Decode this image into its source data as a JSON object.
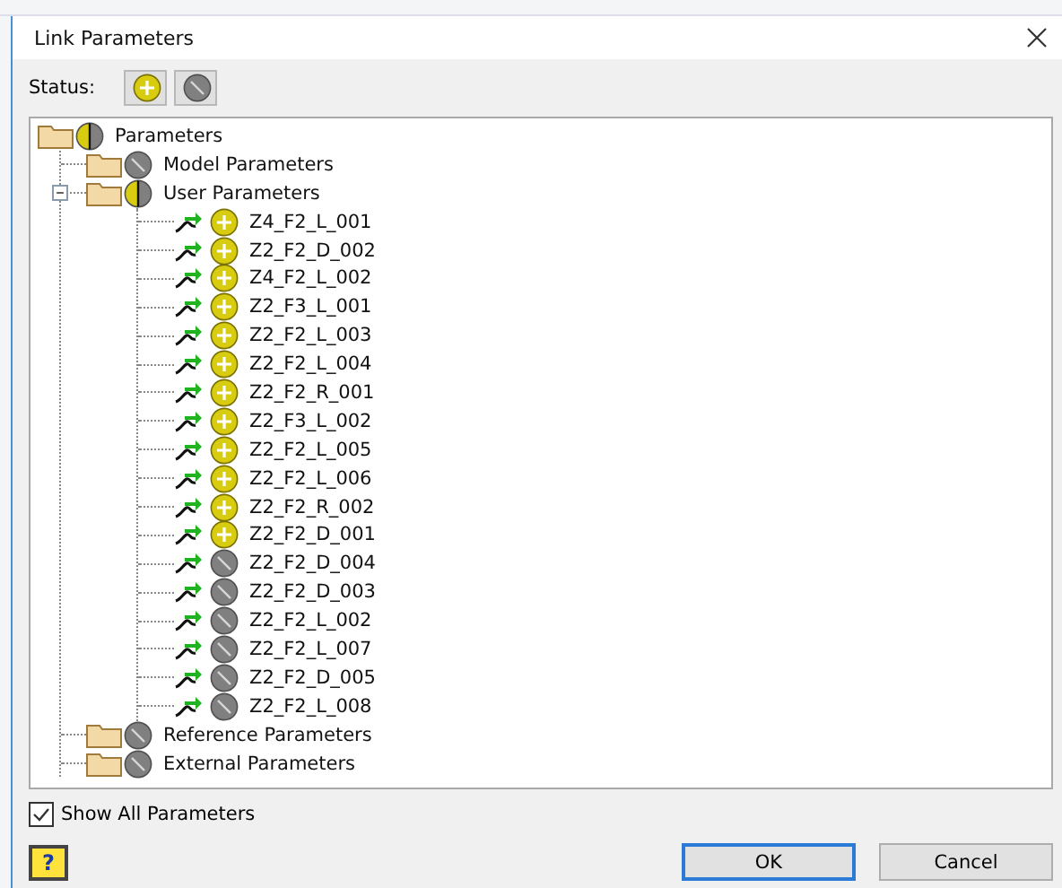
{
  "window": {
    "title": "Link Parameters"
  },
  "status_filter": {
    "label": "Status:",
    "buttons": [
      {
        "kind": "linked"
      },
      {
        "kind": "unlinked"
      }
    ]
  },
  "tree": [
    {
      "label": "Parameters",
      "kind": "folder",
      "linked": true,
      "mixed": true,
      "children": [
        {
          "label": "Model Parameters",
          "kind": "folder",
          "linked": false,
          "mixed": false
        },
        {
          "label": "User Parameters",
          "kind": "folder",
          "linked": true,
          "mixed": true,
          "expanded": true,
          "children": [
            {
              "label": "Z4_F2_L_001",
              "kind": "param",
              "linked": true,
              "mixed": false
            },
            {
              "label": "Z2_F2_D_002",
              "kind": "param",
              "linked": true,
              "mixed": false
            },
            {
              "label": "Z4_F2_L_002",
              "kind": "param",
              "linked": true,
              "mixed": false
            },
            {
              "label": "Z2_F3_L_001",
              "kind": "param",
              "linked": true,
              "mixed": false
            },
            {
              "label": "Z2_F2_L_003",
              "kind": "param",
              "linked": true,
              "mixed": false
            },
            {
              "label": "Z2_F2_L_004",
              "kind": "param",
              "linked": true,
              "mixed": false
            },
            {
              "label": "Z2_F2_R_001",
              "kind": "param",
              "linked": true,
              "mixed": false
            },
            {
              "label": "Z2_F3_L_002",
              "kind": "param",
              "linked": true,
              "mixed": false
            },
            {
              "label": "Z2_F2_L_005",
              "kind": "param",
              "linked": true,
              "mixed": false
            },
            {
              "label": "Z2_F2_L_006",
              "kind": "param",
              "linked": true,
              "mixed": false
            },
            {
              "label": "Z2_F2_R_002",
              "kind": "param",
              "linked": true,
              "mixed": false
            },
            {
              "label": "Z2_F2_D_001",
              "kind": "param",
              "linked": true,
              "mixed": false
            },
            {
              "label": "Z2_F2_D_004",
              "kind": "param",
              "linked": false,
              "mixed": false
            },
            {
              "label": "Z2_F2_D_003",
              "kind": "param",
              "linked": false,
              "mixed": false
            },
            {
              "label": "Z2_F2_L_002",
              "kind": "param",
              "linked": false,
              "mixed": false
            },
            {
              "label": "Z2_F2_L_007",
              "kind": "param",
              "linked": false,
              "mixed": false
            },
            {
              "label": "Z2_F2_D_005",
              "kind": "param",
              "linked": false,
              "mixed": false
            },
            {
              "label": "Z2_F2_L_008",
              "kind": "param",
              "linked": false,
              "mixed": false
            }
          ]
        },
        {
          "label": "Reference Parameters",
          "kind": "folder",
          "linked": false,
          "mixed": false
        },
        {
          "label": "External Parameters",
          "kind": "folder",
          "linked": false,
          "mixed": false
        }
      ]
    }
  ],
  "show_all": {
    "label": "Show All Parameters",
    "checked": true
  },
  "help_button": {
    "icon": "?"
  },
  "buttons": [
    {
      "label": "OK",
      "default": true
    },
    {
      "label": "Cancel",
      "default": false
    }
  ]
}
